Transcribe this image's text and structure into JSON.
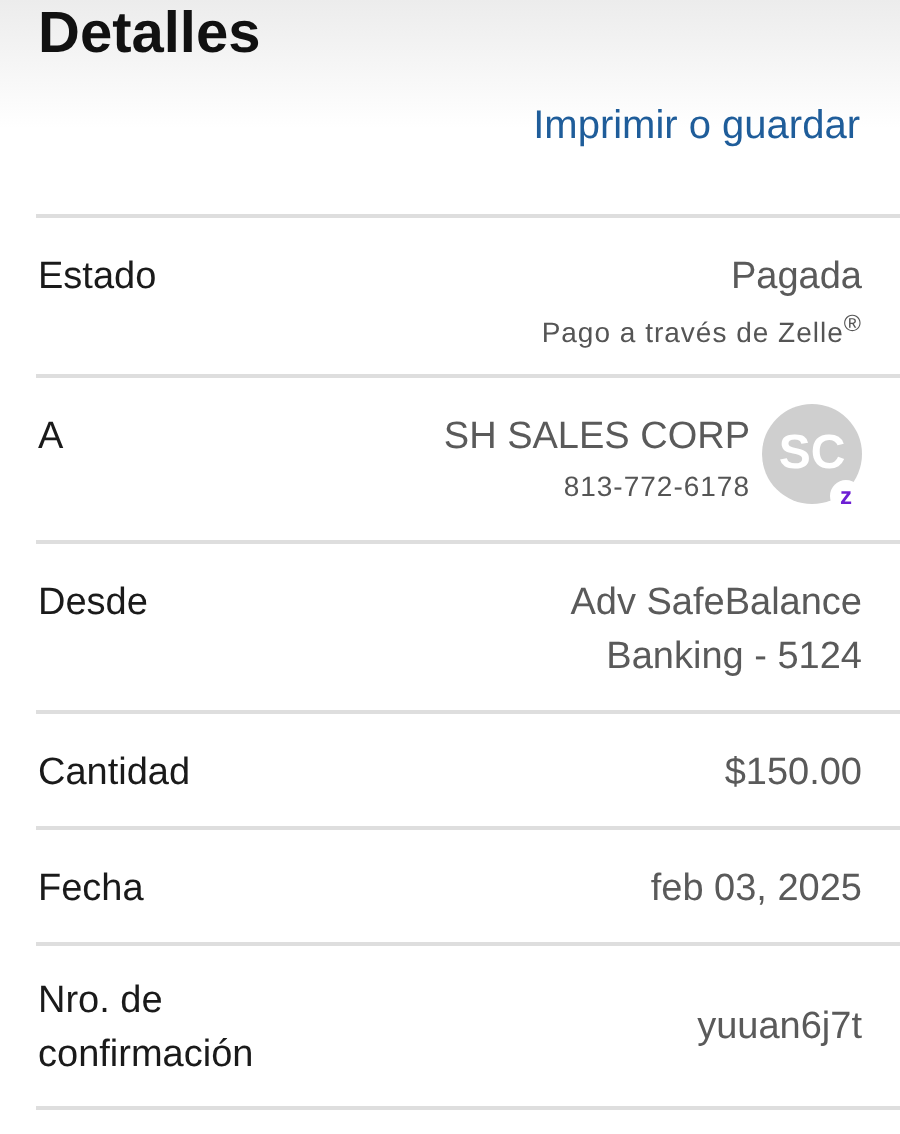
{
  "title": "Detalles",
  "link": "Imprimir o guardar",
  "rows": [
    {
      "kind": "text",
      "label": "Estado",
      "value": "Pagada",
      "sub": "Pago a través de Zelle$^{®}$"
    },
    {
      "kind": "avatar",
      "label": "A",
      "value": "SH SALES CORP",
      "sub": "813-772-6178",
      "initials": "SC",
      "badge": "z"
    },
    {
      "kind": "text",
      "label": "Desde",
      "value": "Adv SafeBalance Banking - 5124"
    },
    {
      "kind": "text",
      "label": "Cantidad",
      "value": "$150.00"
    },
    {
      "kind": "text",
      "label": "Fecha",
      "value": "feb 03, 2025"
    },
    {
      "kind": "text",
      "label": "Nro. de confirmación",
      "value": "yuuan6j7t"
    }
  ]
}
